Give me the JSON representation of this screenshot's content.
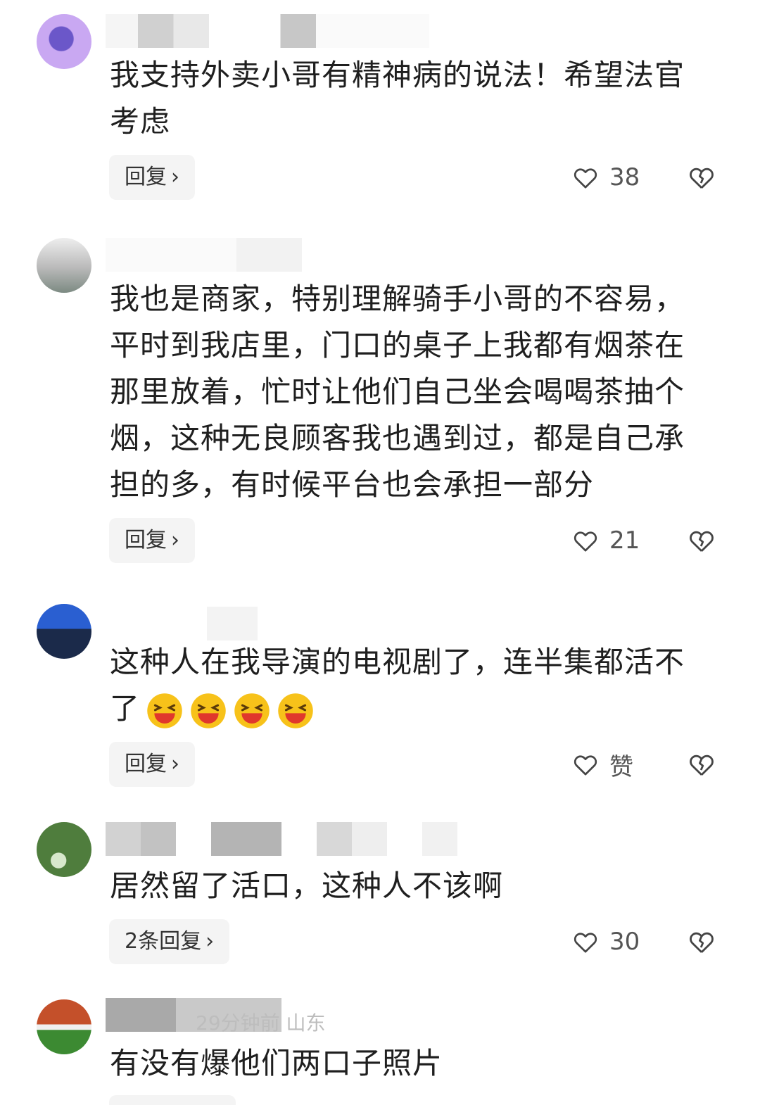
{
  "comments": [
    {
      "text": "我支持外卖小哥有精神病的说法！希望法官考虑",
      "reply_label": "回复",
      "like_count": "38"
    },
    {
      "text": "我也是商家，特别理解骑手小哥的不容易，平时到我店里，门口的桌子上我都有烟茶在那里放着，忙时让他们自己坐会喝喝茶抽个烟，这种无良顾客我也遇到过，都是自己承担的多，有时候平台也会承担一部分",
      "reply_label": "回复",
      "like_count": "21"
    },
    {
      "text": "这种人在我导演的电视剧了，连半集都活不了",
      "reply_label": "回复",
      "like_count": "赞"
    },
    {
      "text": "居然留了活口，这种人不该啊",
      "reply_label": "2条回复",
      "like_count": "30"
    },
    {
      "text": "有没有爆他们两口子照片",
      "meta_text": "29分钟前 山东"
    }
  ],
  "icons": {
    "like": "heart-outline-icon",
    "dislike": "broken-heart-icon",
    "chevron": "chevron-right-icon",
    "emoji": "laughing-emoji-icon"
  },
  "colors": {
    "text": "#1f1f1f",
    "button_bg": "#f4f4f4",
    "muted": "#555555",
    "emoji": "#f7c21a"
  }
}
